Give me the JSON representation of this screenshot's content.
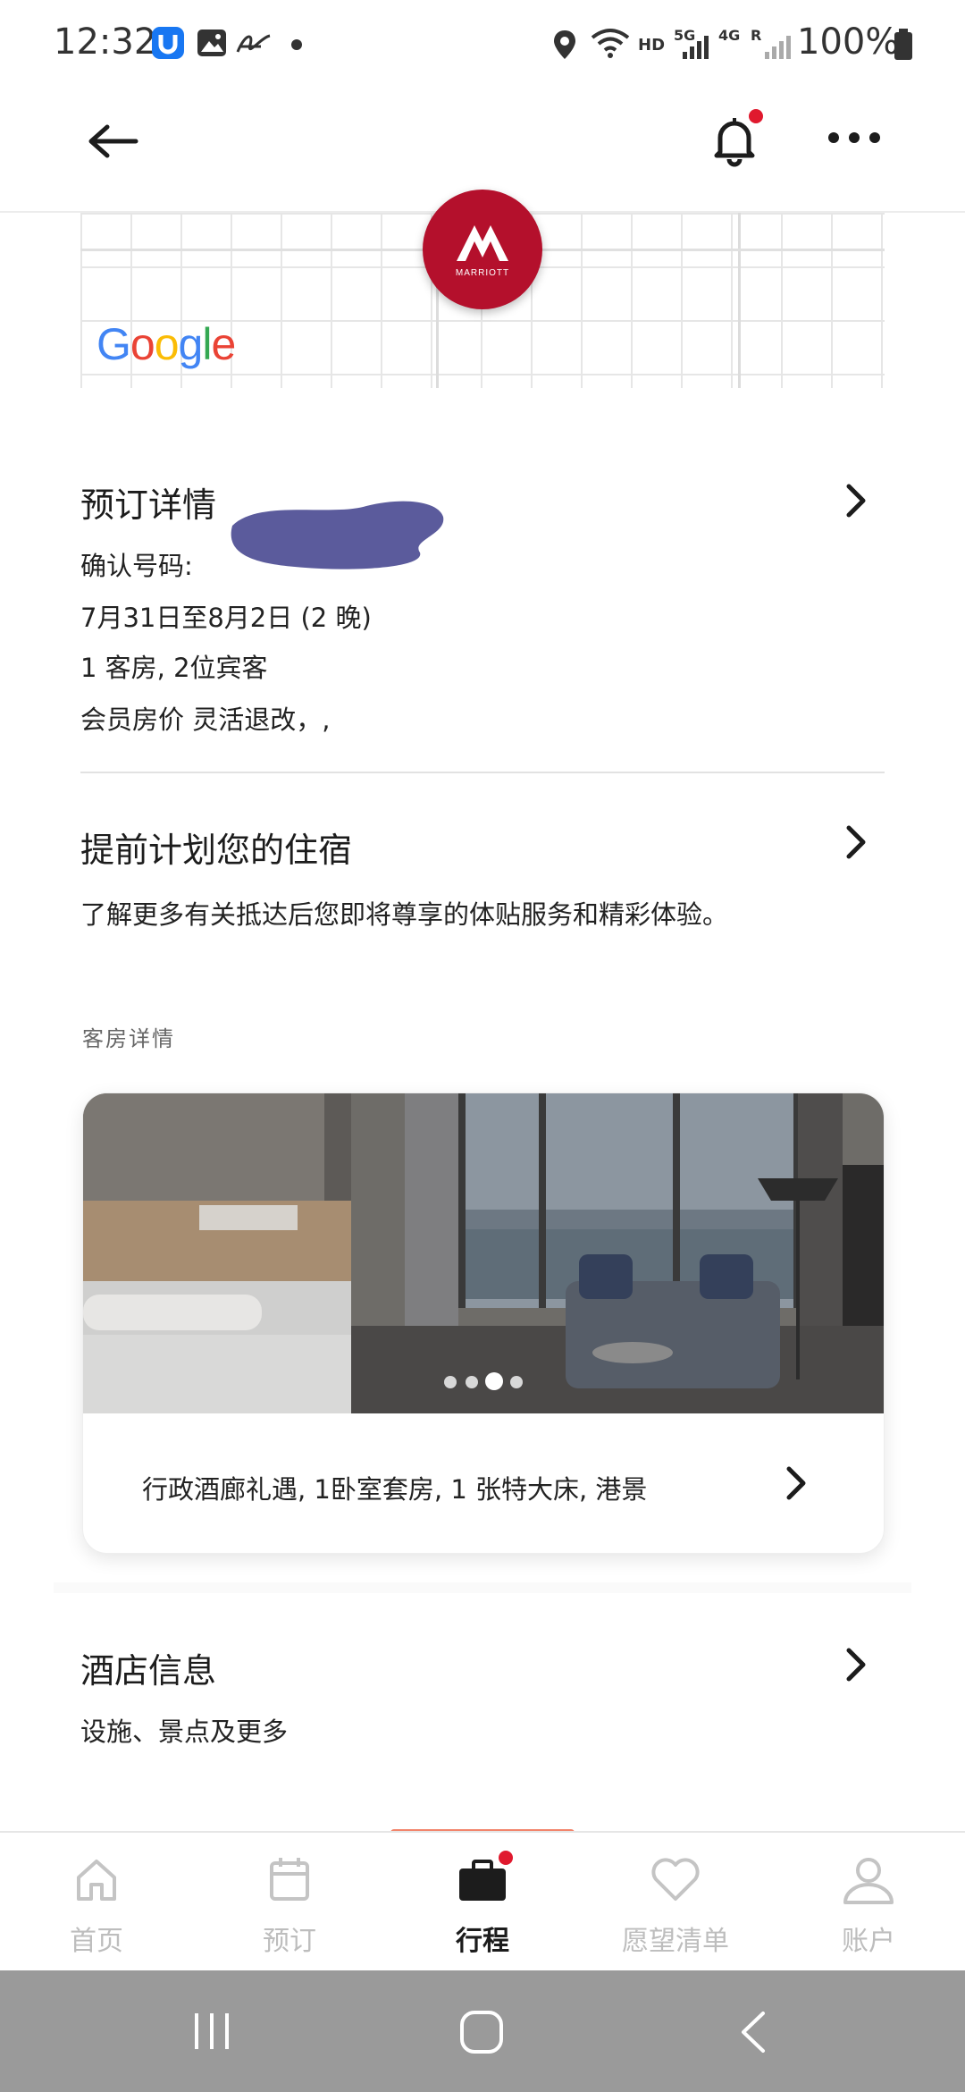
{
  "status_bar": {
    "time": "12:32",
    "network_hd": "HD",
    "network_5g": "5G",
    "network_4g": "4G",
    "roaming": "R",
    "battery_pct": "100%"
  },
  "map": {
    "attribution": "Google",
    "brand_logo_text": "MARRIOTT"
  },
  "reservation": {
    "title": "预订详情",
    "confirmation_label": "确认号码:",
    "dates": "7月31日至8月2日 (2 晚)",
    "guests": "1 客房, 2位宾客",
    "rate": "会员房价 灵活退改，,"
  },
  "plan_stay": {
    "title": "提前计划您的住宿",
    "description": "了解更多有关抵达后您即将尊享的体贴服务和精彩体验。"
  },
  "room_details": {
    "section_label": "客房详情",
    "carousel_count": 4,
    "carousel_active_index": 3,
    "room_name": "行政酒廊礼遇, 1卧室套房, 1 张特大床, 港景"
  },
  "hotel_info": {
    "title": "酒店信息",
    "description": "设施、景点及更多"
  },
  "bottom_nav": {
    "items": [
      {
        "label": "首页",
        "icon": "home-icon"
      },
      {
        "label": "预订",
        "icon": "calendar-icon"
      },
      {
        "label": "行程",
        "icon": "briefcase-icon"
      },
      {
        "label": "愿望清单",
        "icon": "heart-icon"
      },
      {
        "label": "账户",
        "icon": "person-icon"
      }
    ],
    "active_index": 2
  },
  "colors": {
    "brand": "#b4102c",
    "accent_indicator": "#f2856c",
    "notification_dot": "#e0192e"
  }
}
